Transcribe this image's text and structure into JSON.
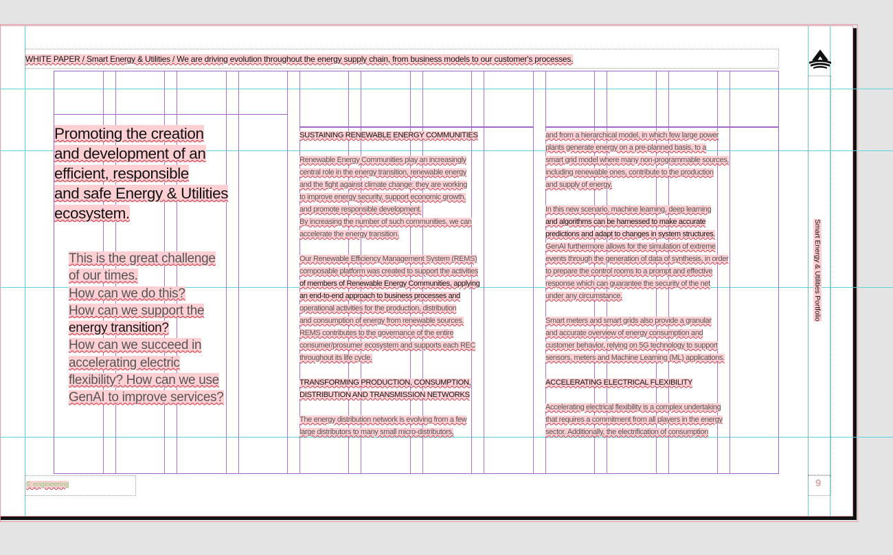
{
  "header": {
    "running_title": "WHITE PAPER / Smart Energy & Utilities / We are driving evolution throughout the energy supply chain, from business models to our customer's processes."
  },
  "sidebar": {
    "vertical_title": "Smart Energy & Utilities Portfolio",
    "page_number": "9",
    "logo_icon": "company-logo-icon"
  },
  "footer": {
    "brand": "© engineering"
  },
  "left": {
    "title_lines": [
      "Promoting the creation",
      "and development of an",
      "efficient, responsible",
      "and safe Energy & Utilities",
      "ecosystem."
    ],
    "challenge_lines": [
      "This is the great challenge",
      "of our times.",
      "How can we do this?",
      "How can we support the",
      "energy transition?",
      "How can we succeed in",
      "accelerating electric",
      "flexibility? How can we use",
      "GenAI to improve services?"
    ]
  },
  "col2": {
    "heading1": "SUSTAINING RENEWABLE ENERGY COMMUNITIES",
    "para1": [
      "Renewable Energy Communities play an increasingly",
      "central role in the energy transition, renewable energy",
      "and the fight against climate change: they are working",
      "to improve energy security, support economic growth,",
      "and promote responsible development.",
      "By increasing the number of such communities, we can",
      "accelerate the energy transition."
    ],
    "para2": [
      "Our Renewable Efficiency Management System (REMS)",
      "composable platform was created to support the activities",
      "of members of Renewable Energy Communities, applying",
      "an end-to-end approach to business processes and",
      "operational activities for the production, distribution",
      "and consumption of energy from renewable sources.",
      "REMS contributes to the governance of the entire",
      "consumer/prosumer ecosystem and supports each REC",
      "throughout its life cycle."
    ],
    "heading2": [
      "TRANSFORMING PRODUCTION, CONSUMPTION,",
      "DISTRIBUTION AND TRANSMISSION NETWORKS"
    ],
    "para3": [
      "The energy distribution network is evolving from a few",
      "large distributors to many small micro-distributors,"
    ]
  },
  "col3": {
    "para1": [
      "and from a hierarchical model, in which few large power",
      "plants generate energy on a pre-planned basis, to a",
      "smart grid model where many non-programmable sources,",
      "including renewable ones, contribute to the production",
      "and supply of energy."
    ],
    "para2": [
      "In this new scenario, machine learning, deep learning",
      "and algorithms can be harnessed to make accurate",
      "predictions and adapt to changes in system structures.",
      "GenAI furthermore allows for the simulation of extreme",
      "events through the generation of data of synthesis, in order",
      "to prepare the control rooms to a prompt and effective",
      "response which can guarantee the security of the net",
      "under any circumstance."
    ],
    "para3": [
      "Smart meters and smart grids also provide a granular",
      "and accurate overview of energy consumption and",
      "customer behavior, relying on 5G technology to support",
      "sensors, meters and Machine Learning (ML) applications."
    ],
    "heading": "ACCELERATING ELECTRICAL FLEXIBILITY",
    "para4": [
      "Accelerating electrical flexibility is a complex undertaking",
      "that requires a commitment from all players in the energy",
      "sector. Additionally, the electrification of consumption"
    ]
  },
  "colors": {
    "highlight": "#ffd0d3",
    "guide": "#5ad6dc",
    "column_guide": "#b06fd6",
    "link_blue": "#78b8f0"
  }
}
